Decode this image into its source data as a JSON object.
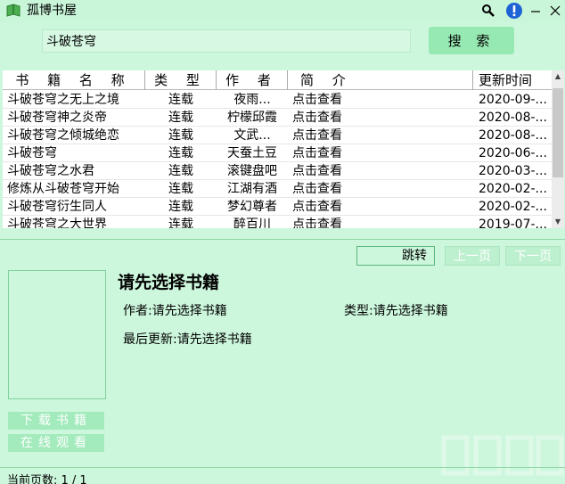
{
  "window": {
    "title": "孤博书屋"
  },
  "search": {
    "value": "斗破苍穹",
    "button_label": "搜 索"
  },
  "table": {
    "columns": [
      "书 籍 名 称",
      "类 型",
      "作 者",
      "简 介",
      "更新时间"
    ],
    "rows": [
      [
        "斗破苍穹之无上之境",
        "连载",
        "夜雨...",
        "点击查看",
        "2020-09-..."
      ],
      [
        "斗破苍穹神之炎帝",
        "连载",
        "柠檬邱霞",
        "点击查看",
        "2020-08-..."
      ],
      [
        "斗破苍穹之倾城绝恋",
        "连载",
        "文武...",
        "点击查看",
        "2020-08-..."
      ],
      [
        "斗破苍穹",
        "连载",
        "天蚕土豆",
        "点击查看",
        "2020-06-..."
      ],
      [
        "斗破苍穹之水君",
        "连载",
        "滚键盘吧",
        "点击查看",
        "2020-03-..."
      ],
      [
        "修炼从斗破苍穹开始",
        "连载",
        "江湖有酒",
        "点击查看",
        "2020-02-..."
      ],
      [
        "斗破苍穹衍生同人",
        "连载",
        "梦幻尊者",
        "点击查看",
        "2020-02-..."
      ],
      [
        "斗破苍穹之大世界",
        "连载",
        "醉百川",
        "点击查看",
        "2019-07-..."
      ]
    ]
  },
  "pager": {
    "jump_label": "跳转",
    "prev_label": "上一页",
    "next_label": "下一页"
  },
  "detail": {
    "title": "请先选择书籍",
    "author": "作者:请先选择书籍",
    "type": "类型:请先选择书籍",
    "updated": "最后更新:请先选择书籍"
  },
  "actions": {
    "download": "下载书籍",
    "read_online": "在线观看"
  },
  "status": {
    "page_info": "当前页数: 1 / 1"
  },
  "colors": {
    "background": "#cdf7dd",
    "accent": "#97e9b3"
  },
  "icons": [
    "book-icon",
    "search-icon",
    "info-icon",
    "minimize-icon",
    "close-icon"
  ]
}
